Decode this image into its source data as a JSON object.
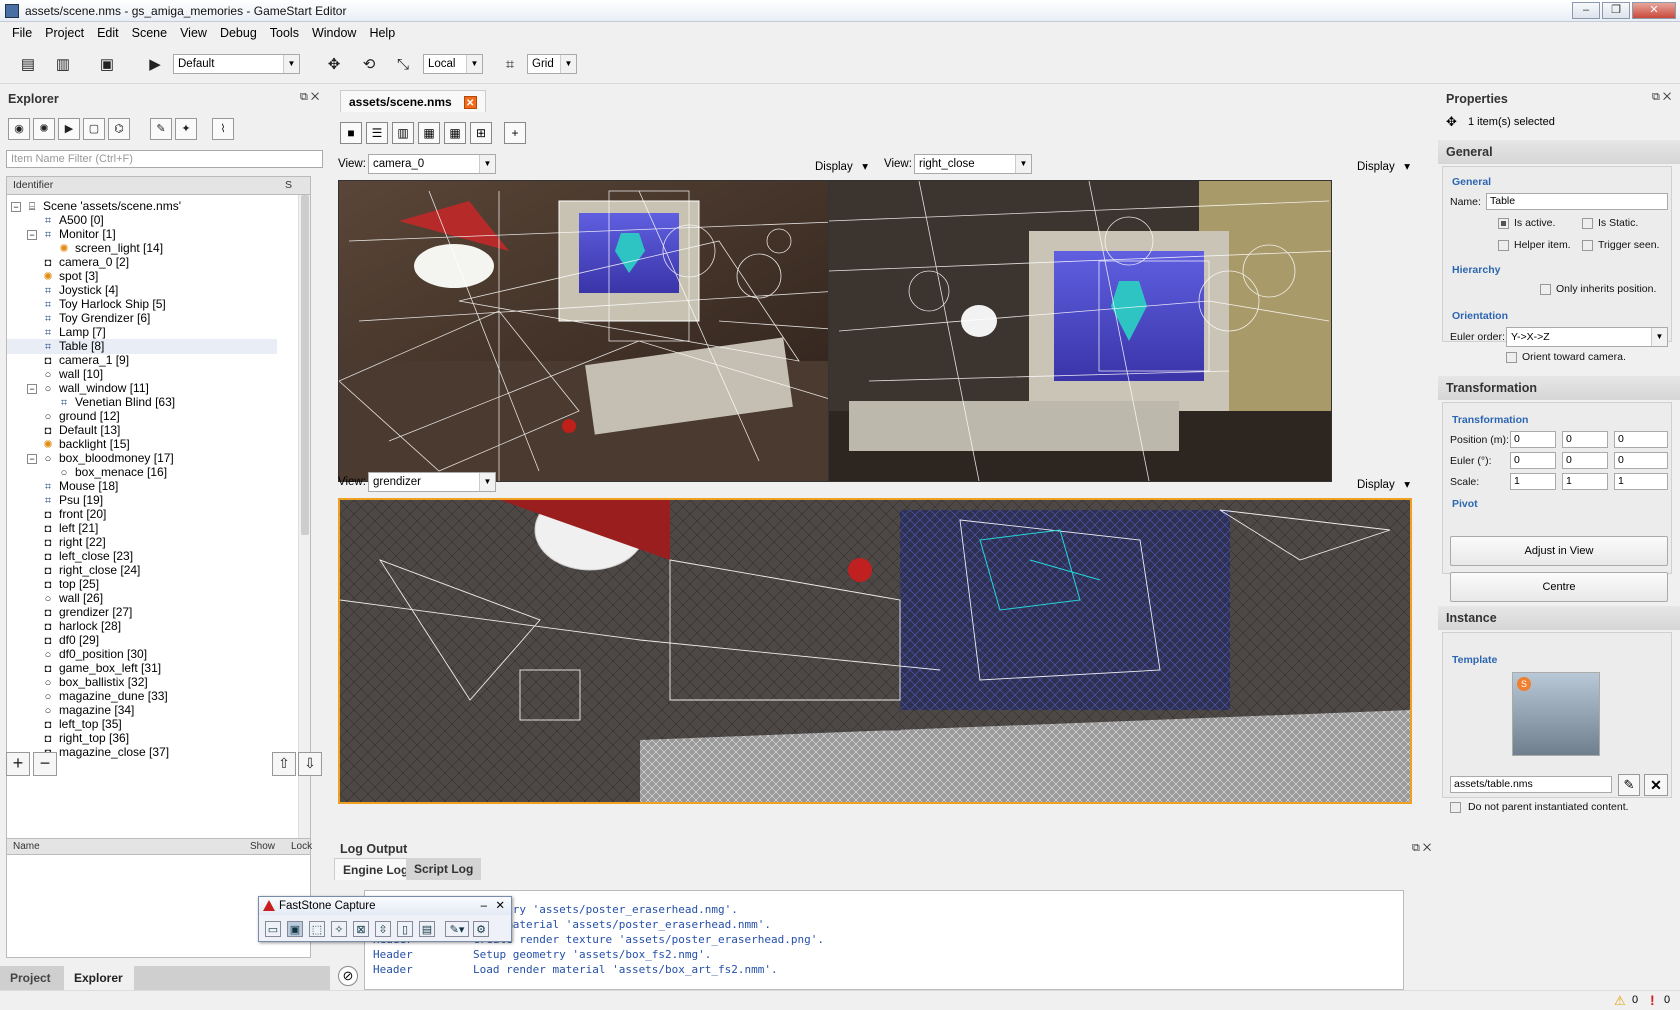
{
  "window": {
    "title": "assets/scene.nms - gs_amiga_memories - GameStart Editor",
    "min": "–",
    "max": "❐",
    "close": "✕"
  },
  "menu": [
    "File",
    "Project",
    "Edit",
    "Scene",
    "View",
    "Debug",
    "Tools",
    "Window",
    "Help"
  ],
  "toolbar": {
    "profile": "Default",
    "space": "Local",
    "snap": "Grid"
  },
  "explorer": {
    "title": "Explorer",
    "filter_placeholder": "Item Name Filter (Ctrl+F)",
    "col_identifier": "Identifier",
    "col_s": "S",
    "tree": [
      {
        "label": "Scene 'assets/scene.nms'",
        "depth": 0,
        "exp": "−",
        "icon": "scene"
      },
      {
        "label": "A500 [0]",
        "depth": 1,
        "icon": "node"
      },
      {
        "label": "Monitor [1]",
        "depth": 1,
        "exp": "−",
        "icon": "node"
      },
      {
        "label": "screen_light [14]",
        "depth": 2,
        "icon": "light"
      },
      {
        "label": "camera_0 [2]",
        "depth": 1,
        "icon": "camera"
      },
      {
        "label": "spot [3]",
        "depth": 1,
        "icon": "light"
      },
      {
        "label": "Joystick [4]",
        "depth": 1,
        "icon": "node"
      },
      {
        "label": "Toy Harlock Ship [5]",
        "depth": 1,
        "icon": "node"
      },
      {
        "label": "Toy Grendizer [6]",
        "depth": 1,
        "icon": "node"
      },
      {
        "label": "Lamp [7]",
        "depth": 1,
        "icon": "node"
      },
      {
        "label": "Table [8]",
        "depth": 1,
        "icon": "node",
        "selected": true
      },
      {
        "label": "camera_1 [9]",
        "depth": 1,
        "icon": "camera"
      },
      {
        "label": "wall [10]",
        "depth": 1,
        "icon": "object"
      },
      {
        "label": "wall_window [11]",
        "depth": 1,
        "exp": "−",
        "icon": "object"
      },
      {
        "label": "Venetian Blind [63]",
        "depth": 2,
        "icon": "node"
      },
      {
        "label": "ground [12]",
        "depth": 1,
        "icon": "object"
      },
      {
        "label": "Default [13]",
        "depth": 1,
        "icon": "camera"
      },
      {
        "label": "backlight [15]",
        "depth": 1,
        "icon": "light"
      },
      {
        "label": "box_bloodmoney [17]",
        "depth": 1,
        "exp": "−",
        "icon": "object"
      },
      {
        "label": "box_menace [16]",
        "depth": 2,
        "icon": "object"
      },
      {
        "label": "Mouse [18]",
        "depth": 1,
        "icon": "node"
      },
      {
        "label": "Psu [19]",
        "depth": 1,
        "icon": "node"
      },
      {
        "label": "front [20]",
        "depth": 1,
        "icon": "camera"
      },
      {
        "label": "left [21]",
        "depth": 1,
        "icon": "camera"
      },
      {
        "label": "right [22]",
        "depth": 1,
        "icon": "camera"
      },
      {
        "label": "left_close [23]",
        "depth": 1,
        "icon": "camera"
      },
      {
        "label": "right_close [24]",
        "depth": 1,
        "icon": "camera"
      },
      {
        "label": "top [25]",
        "depth": 1,
        "icon": "camera"
      },
      {
        "label": "wall [26]",
        "depth": 1,
        "icon": "object"
      },
      {
        "label": "grendizer [27]",
        "depth": 1,
        "icon": "camera"
      },
      {
        "label": "harlock [28]",
        "depth": 1,
        "icon": "camera"
      },
      {
        "label": "df0 [29]",
        "depth": 1,
        "icon": "camera"
      },
      {
        "label": "df0_position [30]",
        "depth": 1,
        "icon": "object"
      },
      {
        "label": "game_box_left [31]",
        "depth": 1,
        "icon": "camera"
      },
      {
        "label": "box_ballistix [32]",
        "depth": 1,
        "icon": "object"
      },
      {
        "label": "magazine_dune [33]",
        "depth": 1,
        "icon": "object"
      },
      {
        "label": "magazine [34]",
        "depth": 1,
        "icon": "object"
      },
      {
        "label": "left_top [35]",
        "depth": 1,
        "icon": "camera"
      },
      {
        "label": "right_top [36]",
        "depth": 1,
        "icon": "camera"
      },
      {
        "label": "magazine_close [37]",
        "depth": 1,
        "icon": "camera"
      }
    ],
    "layers": {
      "col_name": "Name",
      "col_show": "Show",
      "col_lock": "Lock"
    },
    "tabs": [
      "Project",
      "Explorer"
    ]
  },
  "document": {
    "tab": "assets/scene.nms",
    "view_label": "View:",
    "display": "Display",
    "views": [
      "camera_0",
      "right_close",
      "grendizer"
    ]
  },
  "log": {
    "title": "Log Output",
    "tabs": [
      "Engine Log",
      "Script Log"
    ],
    "lines": [
      {
        "source": "",
        "text": "geometry 'assets/poster_eraserhead.nmg'."
      },
      {
        "source": "",
        "text": "nder material 'assets/poster_eraserhead.nmm'."
      },
      {
        "source": "Header",
        "text": "Create render texture 'assets/poster_eraserhead.png'."
      },
      {
        "source": "Header",
        "text": "Setup geometry 'assets/box_fs2.nmg'."
      },
      {
        "source": "Header",
        "text": "Load render material 'assets/box_art_fs2.nmm'."
      }
    ]
  },
  "faststone": {
    "title": "FastStone Capture"
  },
  "properties": {
    "title": "Properties",
    "selected": "1 item(s) selected",
    "general_section": "General",
    "general_sub": "General",
    "name_label": "Name:",
    "name_value": "Table",
    "is_active": "Is active.",
    "is_static": "Is Static.",
    "helper_item": "Helper item.",
    "trigger_seen": "Trigger seen.",
    "hierarchy_sub": "Hierarchy",
    "only_inherits": "Only inherits position.",
    "orientation_sub": "Orientation",
    "euler_order_label": "Euler order:",
    "euler_order_value": "Y->X->Z",
    "orient_camera": "Orient toward camera.",
    "transformation_section": "Transformation",
    "transformation_sub": "Transformation",
    "position_label": "Position (m):",
    "euler_label": "Euler (°):",
    "scale_label": "Scale:",
    "position": [
      "0",
      "0",
      "0"
    ],
    "euler": [
      "0",
      "0",
      "0"
    ],
    "scale": [
      "1",
      "1",
      "1"
    ],
    "pivot_sub": "Pivot",
    "adjust_button": "Adjust in View",
    "centre_button": "Centre",
    "instance_section": "Instance",
    "template_sub": "Template",
    "template_path": "assets/table.nms",
    "no_parent": "Do not parent instantiated content."
  },
  "status": {
    "warnings": "0",
    "errors": "0"
  }
}
